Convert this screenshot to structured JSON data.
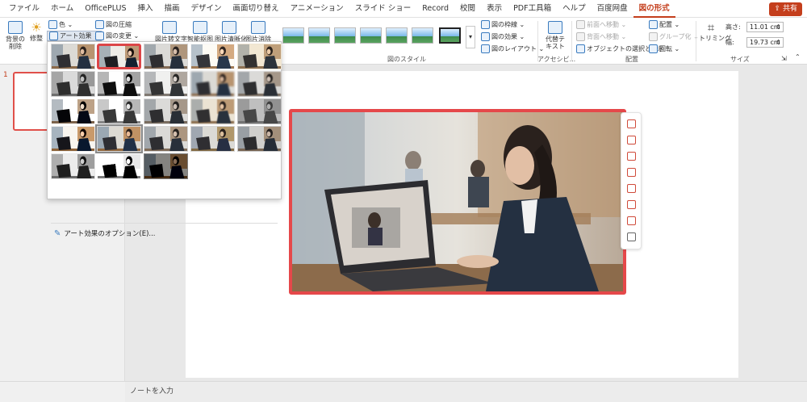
{
  "menu": {
    "tabs": [
      "ファイル",
      "ホーム",
      "OfficePLUS",
      "挿入",
      "描画",
      "デザイン",
      "画面切り替え",
      "アニメーション",
      "スライド ショー",
      "Record",
      "校閲",
      "表示",
      "PDF工具箱",
      "ヘルプ",
      "百度网盘",
      "図の形式"
    ],
    "active_tab": "図の形式",
    "share_label": "共有"
  },
  "ribbon": {
    "remove_bg": "背景の\n削除",
    "corrections": "修整",
    "color": "色",
    "art_effects": "アート効果",
    "compress": "図の圧縮",
    "change_picture": "図の変更",
    "pic_to_text": "図片转文字",
    "smart_crop": "智能抠图",
    "pic_sharpen": "图片清晰化",
    "pic_remove": "图片消除",
    "picture_styles_label": "図のスタイル",
    "border": "図の枠線",
    "effects": "図の効果",
    "layout": "図のレイアウト",
    "alt_text": "代替テ\nキスト",
    "accessibility_label": "アクセシビ...",
    "bring_forward": "前面へ移動",
    "send_backward": "背面へ移動",
    "selection_pane": "オブジェクトの選択と表示",
    "align": "配置",
    "group": "グループ化",
    "rotate": "回転",
    "arrange_label": "配置",
    "crop": "トリミング",
    "height_label": "高さ:",
    "height_value": "11.01 cm",
    "width_label": "幅:",
    "width_value": "19.73 cm",
    "size_label": "サイズ"
  },
  "slides": {
    "number": "1"
  },
  "notes": {
    "placeholder": "ノートを入力"
  },
  "dropdown": {
    "option_label": "アート効果のオプション(E)..."
  },
  "colors": {
    "accent": "#c43e1c",
    "highlight": "#e5484a"
  }
}
